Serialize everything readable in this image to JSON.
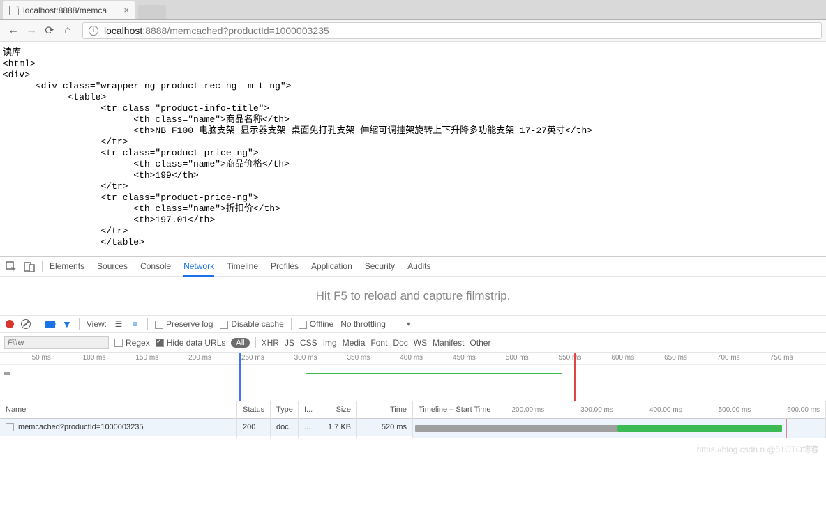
{
  "browser": {
    "tab_title": "localhost:8888/memca",
    "url_host": "localhost",
    "url_port": ":8888",
    "url_path": "/memcached?productId=1000003235"
  },
  "page_content": {
    "line01": "读库",
    "line02": "<html>",
    "line03": "<div>",
    "line04": "      <div class=\"wrapper-ng product-rec-ng  m-t-ng\">",
    "line05": "            <table>",
    "line06": "                  <tr class=\"product-info-title\">",
    "line07": "                        <th class=\"name\">商品名称</th>",
    "line08": "                        <th>NB F100 电脑支架 显示器支架 桌面免打孔支架 伸缩可调挂架旋转上下升降多功能支架 17-27英寸</th>",
    "line09": "                  </tr>",
    "line10": "",
    "line11": "                  <tr class=\"product-price-ng\">",
    "line12": "                        <th class=\"name\">商品价格</th>",
    "line13": "                        <th>199</th>",
    "line14": "                  </tr>",
    "line15": "",
    "line16": "                  <tr class=\"product-price-ng\">",
    "line17": "                        <th class=\"name\">折扣价</th>",
    "line18": "                        <th>197.01</th>",
    "line19": "                  </tr>",
    "line20": "                  </table>"
  },
  "devtools": {
    "tabs": [
      "Elements",
      "Sources",
      "Console",
      "Network",
      "Timeline",
      "Profiles",
      "Application",
      "Security",
      "Audits"
    ],
    "active_tab": "Network",
    "filmstrip_hint": "Hit F5 to reload and capture filmstrip.",
    "toolbar": {
      "view_label": "View:",
      "preserve_log": "Preserve log",
      "disable_cache": "Disable cache",
      "offline": "Offline",
      "throttling": "No throttling"
    },
    "filterbar": {
      "placeholder": "Filter",
      "regex": "Regex",
      "hide_urls": "Hide data URLs",
      "all": "All",
      "types": [
        "XHR",
        "JS",
        "CSS",
        "Img",
        "Media",
        "Font",
        "Doc",
        "WS",
        "Manifest",
        "Other"
      ]
    },
    "overview_ticks": [
      "50 ms",
      "100 ms",
      "150 ms",
      "200 ms",
      "250 ms",
      "300 ms",
      "350 ms",
      "400 ms",
      "450 ms",
      "500 ms",
      "550 ms",
      "600 ms",
      "650 ms",
      "700 ms",
      "750 ms"
    ],
    "columns": {
      "name": "Name",
      "status": "Status",
      "type": "Type",
      "initiator": "I...",
      "size": "Size",
      "time": "Time",
      "waterfall": "Timeline – Start Time"
    },
    "waterfall_ticks": [
      "200.00 ms",
      "300.00 ms",
      "400.00 ms",
      "500.00 ms",
      "600.00 ms"
    ],
    "request": {
      "name": "memcached?productId=1000003235",
      "status": "200",
      "type": "doc...",
      "initiator": "...",
      "size": "1.7 KB",
      "time": "520 ms"
    }
  },
  "watermark": "https://blog.csdn.n @51CTO博客"
}
